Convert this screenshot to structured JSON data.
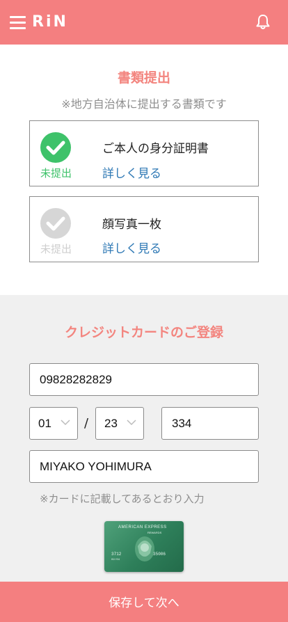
{
  "header": {
    "logo": "RiN",
    "menu_icon": "hamburger-menu-icon",
    "notification_icon": "bell-icon"
  },
  "documents": {
    "title": "書類提出",
    "subtitle": "※地方自治体に提出する書類です",
    "items": [
      {
        "name": "ご本人の身分証明書",
        "status": "未提出",
        "link": "詳しく見る",
        "status_color": "#3ec26a"
      },
      {
        "name": "顔写真一枚",
        "status": "未提出",
        "link": "詳しく見る",
        "status_color": "#cfcfcf"
      }
    ]
  },
  "credit_card": {
    "title": "クレジットカードのご登録",
    "card_number": "09828282829",
    "expiry_month": "01",
    "expiry_separator": "/",
    "expiry_year": "23",
    "cvc": "334",
    "holder_name": "MIYAKO YOHIMURA",
    "note": "※カードに記載してあるとおり入力",
    "card_image": {
      "brand": "AMERICAN EXPRESS",
      "sub": "REWARDS",
      "number_left": "3712",
      "number_right": "35006",
      "expiry": "02/04"
    }
  },
  "footer": {
    "save_label": "保存して次へ"
  },
  "colors": {
    "brand": "#f47f80",
    "accent_text": "#f3857f",
    "link": "#2f79b5"
  }
}
